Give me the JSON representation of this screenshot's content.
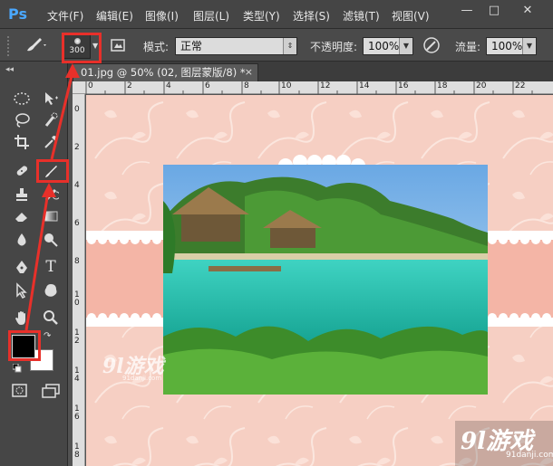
{
  "app": {
    "logo": "Ps"
  },
  "menu": [
    "文件(F)",
    "编辑(E)",
    "图像(I)",
    "图层(L)",
    "类型(Y)",
    "选择(S)",
    "滤镜(T)",
    "视图(V)"
  ],
  "window_controls": {
    "minimize": "—",
    "restore": "□",
    "close": "✕"
  },
  "options": {
    "brush_size": "300",
    "mode_label": "模式:",
    "mode_value": "正常",
    "opacity_label": "不透明度:",
    "opacity_value": "100%",
    "flow_label": "流量:",
    "flow_value": "100%"
  },
  "document_tab": {
    "title": "01.jpg @ 50% (02, 图层蒙版/8) *",
    "close": "×"
  },
  "ruler_h": [
    "0",
    "2",
    "4",
    "6",
    "8",
    "10",
    "12",
    "14",
    "16",
    "18",
    "20",
    "22"
  ],
  "ruler_v": [
    "0",
    "2",
    "4",
    "6",
    "8",
    "1\n0",
    "1\n2",
    "1\n4",
    "1\n6",
    "1\n8"
  ],
  "watermark": {
    "text": "9l游戏",
    "sub": "91danji.com"
  },
  "site_logo": {
    "text": "9l游戏",
    "sub": "91danji.com"
  },
  "colors": {
    "highlight": "#e8302a",
    "foreground": "#000000",
    "background": "#ffffff",
    "canvas_pink": "#f6cfc3"
  },
  "icons": {
    "tools": [
      "marquee-icon",
      "move-icon",
      "lasso-icon",
      "quick-selection-icon",
      "crop-icon",
      "eyedropper-icon",
      "healing-brush-icon",
      "brush-icon",
      "clone-stamp-icon",
      "history-brush-icon",
      "eraser-icon",
      "gradient-icon",
      "blur-icon",
      "dodge-icon",
      "pen-icon",
      "type-icon",
      "path-selection-icon",
      "custom-shape-icon",
      "hand-icon",
      "zoom-icon"
    ]
  }
}
